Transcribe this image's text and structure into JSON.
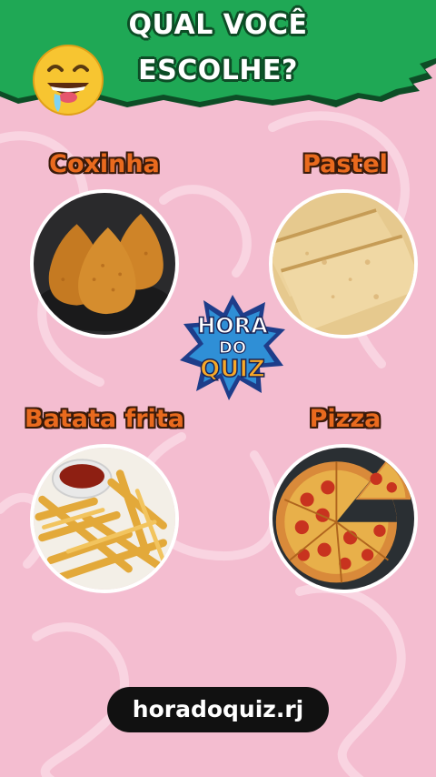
{
  "header": {
    "title_line1": "QUAL VOCÊ",
    "title_line2": "ESCOLHE?",
    "bg_color": "#1fa855",
    "emoji_icon": "drooling-face-icon"
  },
  "options": [
    {
      "label": "Coxinha",
      "icon": "coxinha-image"
    },
    {
      "label": "Pastel",
      "icon": "pastel-image"
    },
    {
      "label": "Batata frita",
      "icon": "french-fries-image"
    },
    {
      "label": "Pizza",
      "icon": "pizza-image"
    }
  ],
  "logo": {
    "line1": "HORA",
    "line2": "DO",
    "line3": "QUIZ"
  },
  "footer": {
    "handle": "horadoquiz.rj"
  },
  "colors": {
    "background": "#f4bdd0",
    "label": "#e96a1e",
    "accent_green": "#1fa855"
  }
}
